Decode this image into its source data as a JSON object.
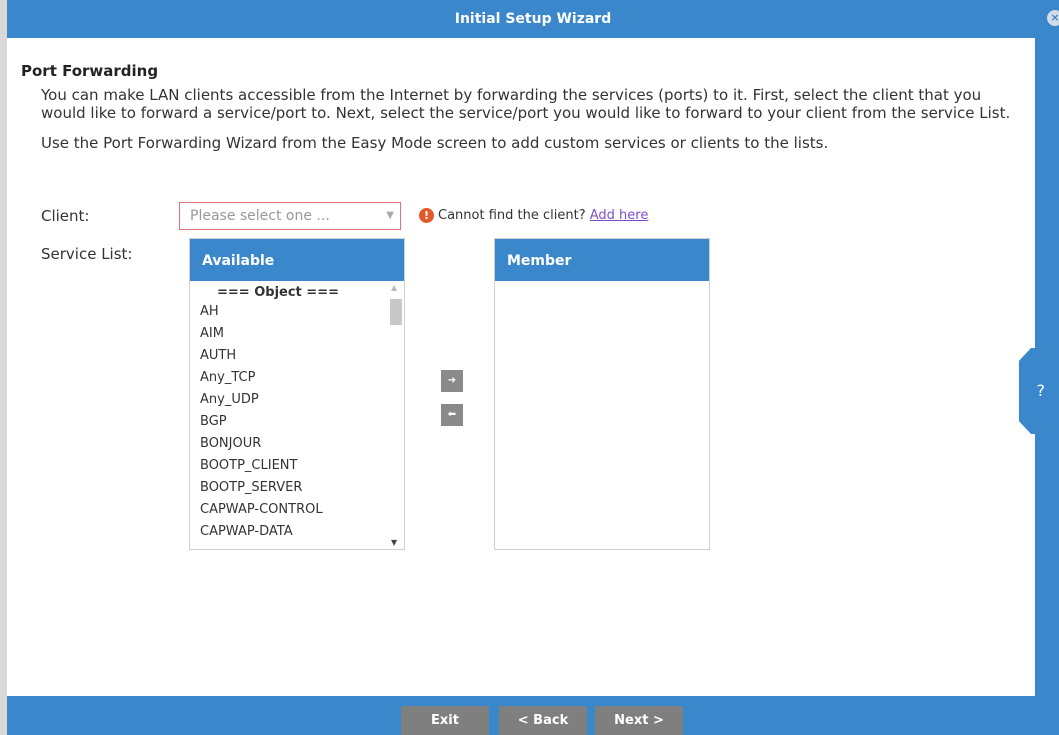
{
  "window": {
    "title": "Initial Setup Wizard",
    "close_glyph": "×"
  },
  "help": {
    "label": "?"
  },
  "page": {
    "title": "Port Forwarding",
    "intro": "You can make LAN clients accessible from the Internet by forwarding the services (ports) to it. First, select the client that you would like to forward a service/port to. Next, select the service/port you would like to forward to your client from the service List.",
    "note": "Use the Port Forwarding Wizard from the Easy Mode screen to add custom services or clients to the lists."
  },
  "client": {
    "label": "Client:",
    "placeholder": "Please select one ...",
    "warning_text": "Cannot find the client?",
    "add_link": "Add here"
  },
  "service_list": {
    "label": "Service List:",
    "available_header": "Available",
    "member_header": "Member",
    "group_label": "=== Object ===",
    "available_items": [
      "AH",
      "AIM",
      "AUTH",
      "Any_TCP",
      "Any_UDP",
      "BGP",
      "BONJOUR",
      "BOOTP_CLIENT",
      "BOOTP_SERVER",
      "CAPWAP-CONTROL",
      "CAPWAP-DATA"
    ],
    "member_items": []
  },
  "icons": {
    "warning": "warning-icon",
    "move_right": "arrow-right-icon",
    "move_left": "arrow-left-icon",
    "dropdown": "chevron-down-icon"
  },
  "footer": {
    "exit_label": "Exit",
    "back_label": "< Back",
    "next_label": "Next >"
  }
}
